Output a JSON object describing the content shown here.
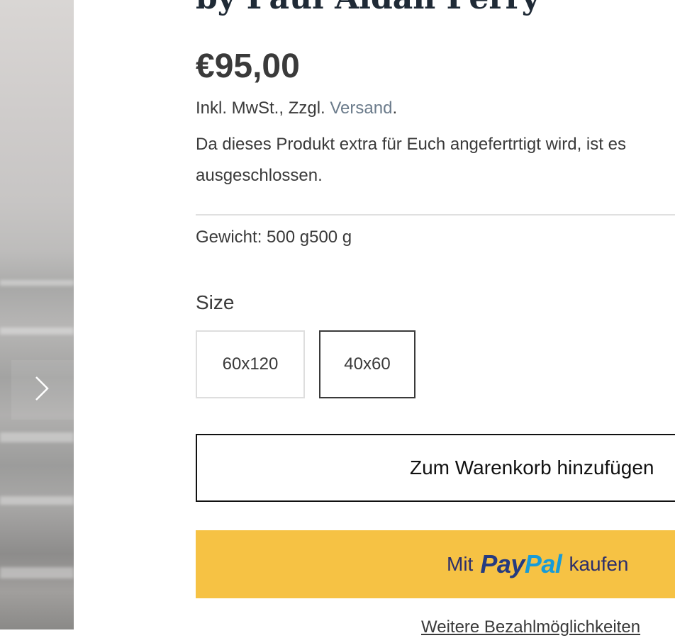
{
  "product": {
    "title": "by Paul Aidan Perry",
    "price": "€95,00",
    "tax_prefix": "Inkl. MwSt., Zzgl. ",
    "shipping_link": "Versand",
    "tax_suffix": ".",
    "notice_line1": "Da dieses Produkt extra für Euch angefertrtigt wird, ist es",
    "notice_line2": "ausgeschlossen.",
    "weight": "Gewicht: 500 g500 g"
  },
  "size": {
    "label": "Size",
    "options": [
      "60x120",
      "40x60"
    ],
    "selected": "40x60"
  },
  "actions": {
    "add_to_cart": "Zum Warenkorb hinzufügen",
    "paypal_prefix": "Mit",
    "paypal_logo_pay": "Pay",
    "paypal_logo_pal": "Pal",
    "paypal_suffix": "kaufen",
    "more_payment": "Weitere Bezahlmöglichkeiten"
  },
  "gallery": {
    "next_icon": "chevron-right-icon"
  },
  "colors": {
    "paypal_button": "#f6c244",
    "link": "#6b7b8b",
    "title": "#1f2a36"
  }
}
